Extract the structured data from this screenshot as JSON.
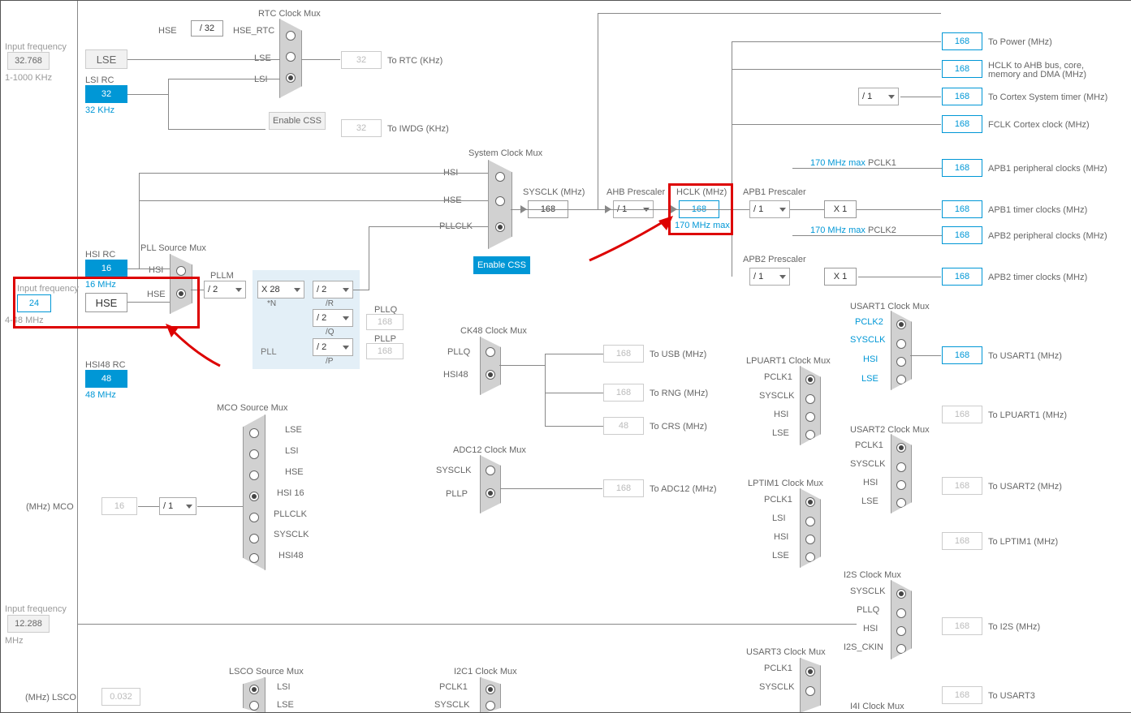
{
  "inputs": {
    "lse_label": "Input frequency",
    "lse_val": "32.768",
    "lse_range": "1-1000 KHz",
    "hse_label": "Input frequency",
    "hse_val": "24",
    "hse_range": "4-48 MHz",
    "i2s_label": "Input frequency",
    "i2s_val": "12.288",
    "i2s_unit": "MHz"
  },
  "src": {
    "lse": "LSE",
    "lsi_rc": "LSI RC",
    "lsi_val": "32",
    "lsi_note": "32 KHz",
    "hsi_rc": "HSI RC",
    "hsi_val": "16",
    "hsi_note": "16 MHz",
    "hse": "HSE",
    "hsi48_rc": "HSI48 RC",
    "hsi48_val": "48",
    "hsi48_note": "48 MHz"
  },
  "rtc": {
    "hse": "HSE",
    "div32": "/ 32",
    "hse_rtc": "HSE_RTC",
    "title": "RTC Clock Mux",
    "lse": "LSE",
    "lsi": "LSI",
    "to_rtc": "To RTC (KHz)",
    "rtc_val": "32",
    "enable_css": "Enable CSS",
    "to_iwdg": "To IWDG (KHz)",
    "iwdg_val": "32"
  },
  "pll": {
    "title": "PLL",
    "srcmux": "PLL Source Mux",
    "hsi": "HSI",
    "hse": "HSE",
    "m_lbl": "PLLM",
    "m_val": "/ 2",
    "n_val": "X 28",
    "n_lbl": "*N",
    "r_val": "/ 2",
    "r_lbl": "/R",
    "q_val": "/ 2",
    "q_lbl": "/Q",
    "p_val": "/ 2",
    "p_lbl": "/P",
    "pllq": "PLLQ",
    "pllq_out": "168",
    "pllp": "PLLP",
    "pllp_out": "168"
  },
  "sysmux": {
    "title": "System Clock Mux",
    "hsi": "HSI",
    "hse": "HSE",
    "pllclk": "PLLCLK",
    "enable_css": "Enable CSS"
  },
  "ahb": {
    "sysclk_lbl": "SYSCLK (MHz)",
    "sysclk_val": "168",
    "presc_lbl": "AHB Prescaler",
    "presc_val": "/ 1",
    "hclk_lbl": "HCLK (MHz)",
    "hclk_val": "168",
    "hclk_max": "170 MHz max"
  },
  "apb1": {
    "lbl": "APB1 Prescaler",
    "val": "/ 1",
    "max": "170 MHz max",
    "pclk1": "PCLK1",
    "mult": "X 1"
  },
  "apb2": {
    "lbl": "APB2 Prescaler",
    "val": "/ 1",
    "max": "170 MHz max",
    "pclk2": "PCLK2",
    "mult": "X 1"
  },
  "out": {
    "power_val": "168",
    "power": "To Power (MHz)",
    "hclk_val": "168",
    "hclk": "HCLK to AHB bus, core, memory and DMA (MHz)",
    "cortex_val": "168",
    "cortex": "To Cortex System timer (MHz)",
    "fclk_val": "168",
    "fclk": "FCLK Cortex clock (MHz)",
    "apb1p_val": "168",
    "apb1p": "APB1 peripheral clocks (MHz)",
    "apb1t_val": "168",
    "apb1t": "APB1 timer clocks (MHz)",
    "apb2p_val": "168",
    "apb2p": "APB2 peripheral clocks (MHz)",
    "apb2t_val": "168",
    "apb2t": "APB2 timer clocks (MHz)"
  },
  "ck48": {
    "title": "CK48 Clock Mux",
    "pllq": "PLLQ",
    "hsi48": "HSI48",
    "usb_val": "168",
    "usb": "To USB (MHz)",
    "rng_val": "168",
    "rng": "To RNG (MHz)",
    "crs_val": "48",
    "crs": "To CRS (MHz)"
  },
  "adc": {
    "title": "ADC12 Clock Mux",
    "sysclk": "SYSCLK",
    "pllp": "PLLP",
    "val": "168",
    "to": "To ADC12 (MHz)"
  },
  "mco": {
    "title": "MCO Source Mux",
    "lse": "LSE",
    "lsi": "LSI",
    "hse": "HSE",
    "hsi16": "HSI 16",
    "pllclk": "PLLCLK",
    "sysclk": "SYSCLK",
    "hsi48": "HSI48",
    "div": "/ 1",
    "val": "16",
    "out": "(MHz) MCO"
  },
  "lsco": {
    "title": "LSCO Source Mux",
    "lsi": "LSI",
    "lse": "LSE",
    "val": "0.032",
    "out": "(MHz) LSCO"
  },
  "i2c1": {
    "title": "I2C1 Clock Mux",
    "pclk1": "PCLK1",
    "sysclk": "SYSCLK"
  },
  "usart1": {
    "title": "USART1 Clock Mux",
    "pclk2": "PCLK2",
    "sysclk": "SYSCLK",
    "hsi": "HSI",
    "lse": "LSE",
    "val": "168",
    "to": "To USART1 (MHz)"
  },
  "lpuart1": {
    "title": "LPUART1 Clock Mux",
    "pclk1": "PCLK1",
    "sysclk": "SYSCLK",
    "hsi": "HSI",
    "lse": "LSE",
    "val": "168",
    "to": "To LPUART1 (MHz)"
  },
  "usart2": {
    "title": "USART2 Clock Mux",
    "pclk1": "PCLK1",
    "sysclk": "SYSCLK",
    "hsi": "HSI",
    "lse": "LSE",
    "val": "168",
    "to": "To USART2 (MHz)"
  },
  "lptim1": {
    "title": "LPTIM1 Clock Mux",
    "pclk1": "PCLK1",
    "lsi": "LSI",
    "hsi": "HSI",
    "lse": "LSE",
    "val": "168",
    "to": "To LPTIM1 (MHz)"
  },
  "i2s": {
    "title": "I2S Clock Mux",
    "sysclk": "SYSCLK",
    "pllq": "PLLQ",
    "hsi": "HSI",
    "ckin": "I2S_CKIN",
    "val": "168",
    "to": "To I2S (MHz)"
  },
  "usart3": {
    "title": "USART3 Clock Mux",
    "pclk1": "PCLK1",
    "sysclk": "SYSCLK",
    "val": "168",
    "to": "To USART3"
  },
  "i4i": {
    "title": "I4I Clock Mux"
  }
}
